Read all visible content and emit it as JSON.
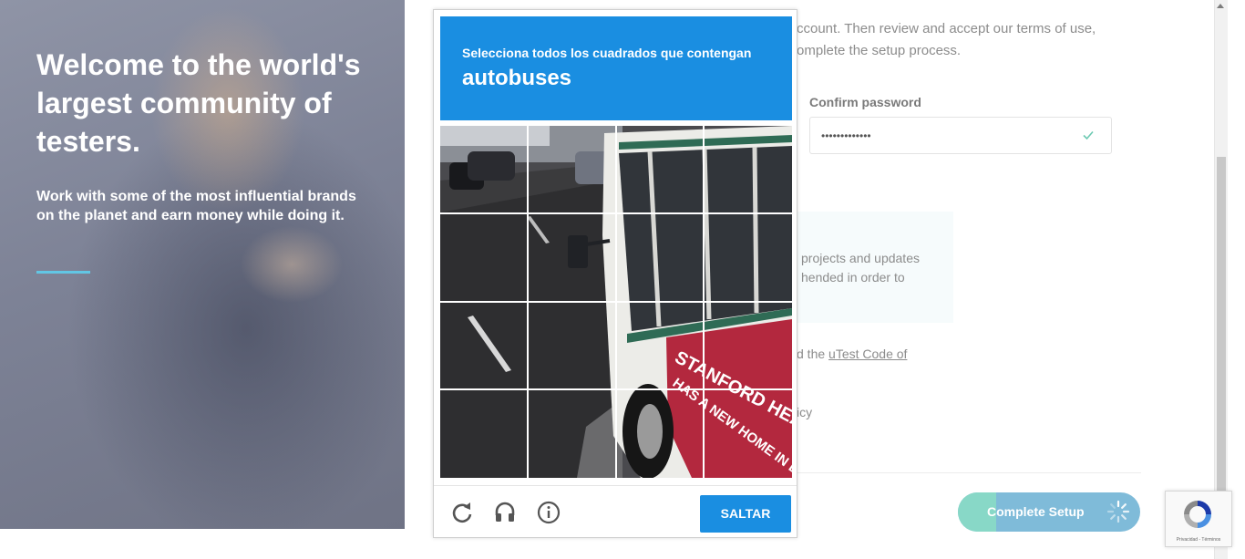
{
  "hero": {
    "title": "Welcome to the world's largest community of testers.",
    "subtitle": "Work with some of the most influential brands on the planet and earn money while doing it.",
    "accent_color": "#62c6e4"
  },
  "form": {
    "intro_line1": "ccount. Then review and accept our terms of use,",
    "intro_line2": "omplete the setup process.",
    "confirm_password_label": "Confirm password",
    "confirm_password_value": "•••••••••••••",
    "info_line1": "projects and updates",
    "info_line2": "hended in order to",
    "code_prefix": "d the ",
    "code_link": "uTest Code of",
    "policy_fragment": "icy",
    "complete_button": "Complete Setup"
  },
  "captcha": {
    "instruction": "Selecciona todos los cuadrados que contengan",
    "object": "autobuses",
    "skip_button": "SALTAR",
    "icons": [
      "reload-icon",
      "audio-headphones-icon",
      "info-icon"
    ],
    "bus_text_line1": "STANFORD HEALTH CA",
    "bus_text_line2": "HAS A NEW HOME IN EMERYVIL",
    "accent_color": "#1a8ee1"
  },
  "recaptcha_badge": {
    "links": "Privacidad - Términos"
  }
}
